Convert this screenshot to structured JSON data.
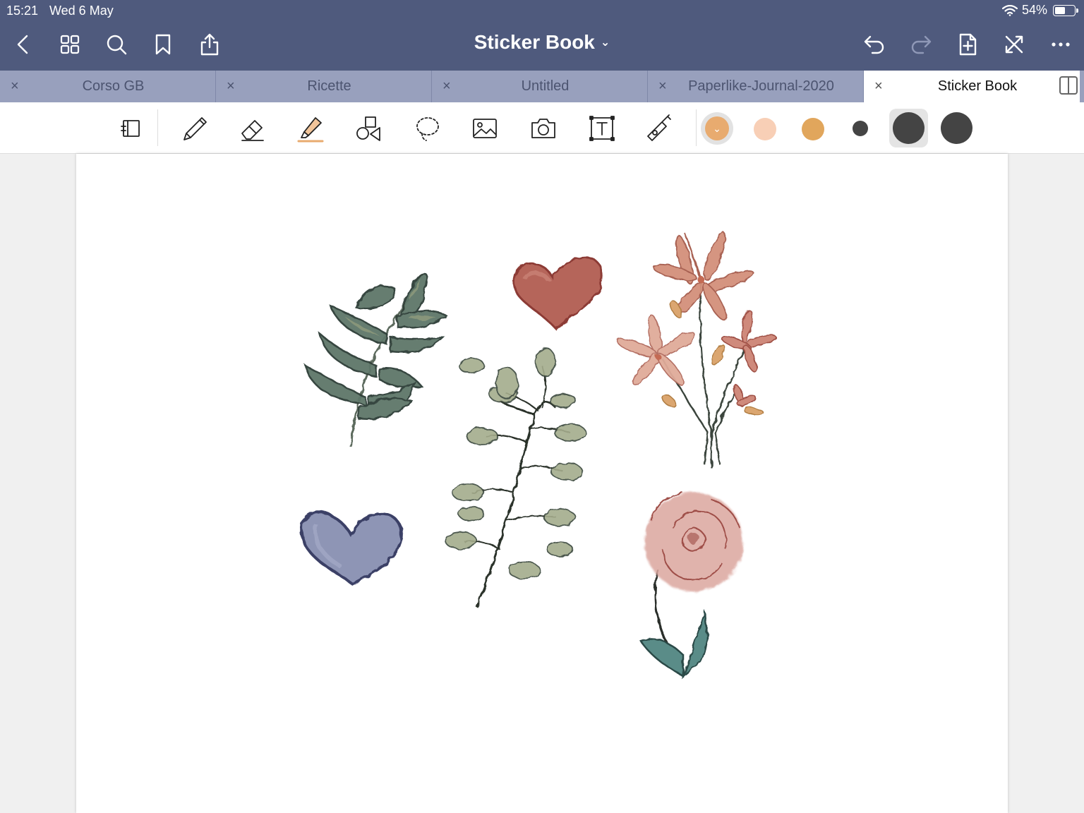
{
  "status_bar": {
    "time": "15:21",
    "date": "Wed 6 May",
    "battery_text": "54%",
    "battery_level": 0.54,
    "wifi_icon": "wifi-icon"
  },
  "nav": {
    "title": "Sticker Book",
    "title_chevron": "⌄",
    "icons": [
      "back-icon",
      "grid-icon",
      "search-icon",
      "bookmark-icon",
      "share-icon",
      "undo-icon",
      "redo-icon",
      "add-page-icon",
      "close-fullscreen-icon",
      "more-icon"
    ]
  },
  "tabs": [
    {
      "label": "Corso GB",
      "active": false
    },
    {
      "label": "Ricette",
      "active": false
    },
    {
      "label": "Untitled",
      "active": false
    },
    {
      "label": "Paperlike-Journal-2020",
      "active": false
    },
    {
      "label": "Sticker Book",
      "active": true
    }
  ],
  "tab_close_glyph": "×",
  "toolbar": {
    "bluetooth_glyph": "✱",
    "tools": [
      "read-only-icon",
      "pen-icon",
      "eraser-icon",
      "highlighter-icon",
      "shapes-icon",
      "lasso-icon",
      "image-icon",
      "camera-icon",
      "text-icon",
      "laser-pointer-icon"
    ],
    "swatch_chevron": "⌄",
    "colors": {
      "highlight_selected": "#e8ab6f",
      "peach": "#f8cfb6",
      "ochre": "#e1a65c",
      "dark": "#444444"
    }
  }
}
